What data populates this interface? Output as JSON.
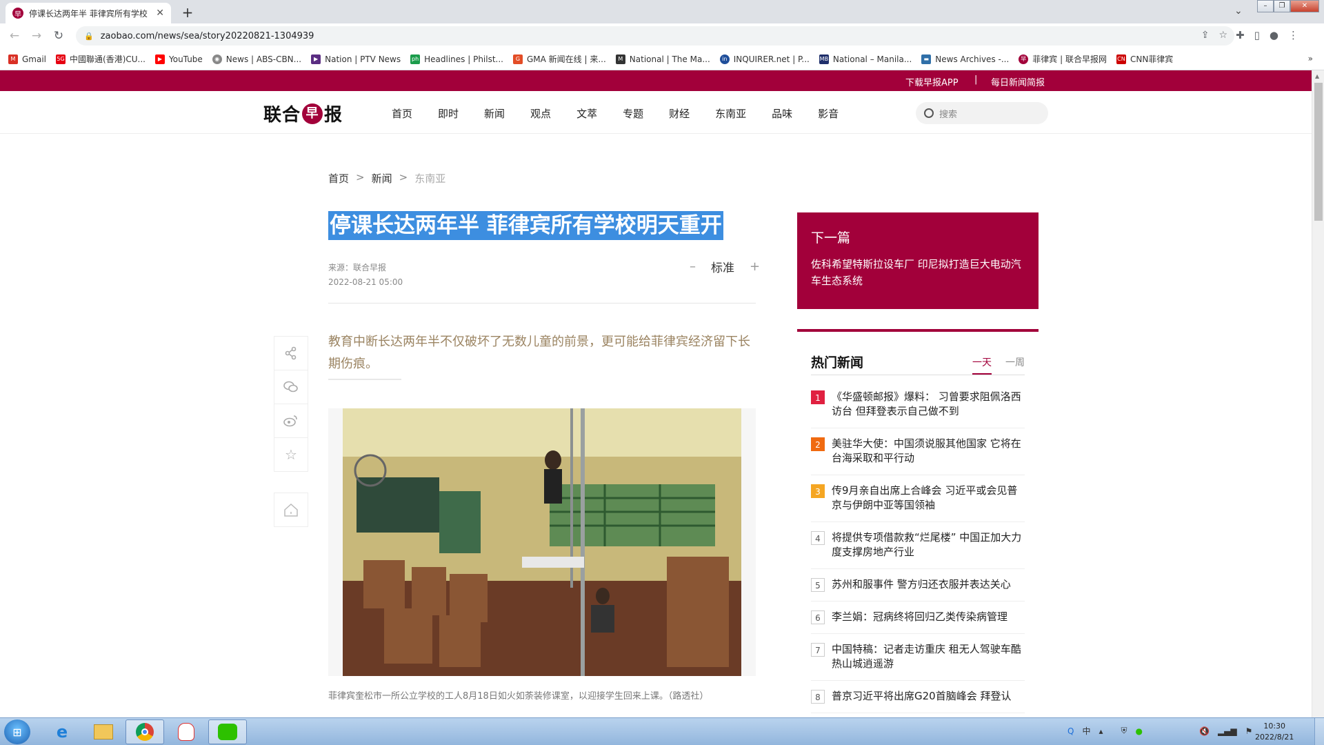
{
  "browser": {
    "tab_title": "停课长达两年半 菲律宾所有学校",
    "favicon_text": "早",
    "url": "zaobao.com/news/sea/story20220821-1304939",
    "bookmarks": [
      {
        "label": "Gmail",
        "color": "#d93025"
      },
      {
        "label": "中國聯通(香港)CU...",
        "color": "#e60012"
      },
      {
        "label": "YouTube",
        "color": "#ff0000"
      },
      {
        "label": "News | ABS-CBN...",
        "color": "#888888"
      },
      {
        "label": "Nation | PTV News",
        "color": "#5a2d82"
      },
      {
        "label": "Headlines | Philst...",
        "color": "#1b9c4b"
      },
      {
        "label": "GMA 新闻在线 | 来...",
        "color": "#e34d26"
      },
      {
        "label": "National | The Ma...",
        "color": "#333333"
      },
      {
        "label": "INQUIRER.net | P...",
        "color": "#1f4e9a"
      },
      {
        "label": "National – Manila...",
        "color": "#1f2f6b"
      },
      {
        "label": "News Archives -...",
        "color": "#2f6fa8"
      },
      {
        "label": "菲律宾 | 联合早报网",
        "color": "#a2003a"
      },
      {
        "label": "CNN菲律宾",
        "color": "#cc0000"
      }
    ]
  },
  "site": {
    "top_links": [
      "下载早报APP",
      "|",
      "每日新闻简报"
    ],
    "logo": {
      "left": "联合",
      "mid": "早",
      "right": "报"
    },
    "nav": [
      "首页",
      "即时",
      "新闻",
      "观点",
      "文萃",
      "专题",
      "财经",
      "东南亚",
      "品味",
      "影音"
    ],
    "search_placeholder": "搜索",
    "accent": "#a2003a"
  },
  "article": {
    "breadcrumb": [
      "首页",
      "新闻",
      "东南亚"
    ],
    "headline": "停课长达两年半 菲律宾所有学校明天重开",
    "source": "来源：联合早报",
    "date": "2022-08-21 05:00",
    "font_minus": "–",
    "font_label": "标准",
    "font_plus": "+",
    "lede": "教育中断长达两年半不仅破坏了无数儿童的前景，更可能给菲律宾经济留下长期伤痕。",
    "caption": "菲律宾奎松市一所公立学校的工人8月18日如火如荼装修课室，以迎接学生回来上课。（路透社）"
  },
  "next_article": {
    "label": "下一篇",
    "title": "佐科希望特斯拉设车厂 印尼拟打造巨大电动汽车生态系统"
  },
  "hot_news": {
    "title": "热门新闻",
    "tabs": [
      "一天",
      "一周"
    ],
    "items": [
      {
        "rank": "1",
        "text": "《华盛顿邮报》爆料： 习曾要求阻佩洛西访台 但拜登表示自己做不到"
      },
      {
        "rank": "2",
        "text": "美驻华大使：中国须说服其他国家 它将在台海采取和平行动"
      },
      {
        "rank": "3",
        "text": "传9月亲自出席上合峰会 习近平或会见普京与伊朗中亚等国领袖"
      },
      {
        "rank": "4",
        "text": "将提供专项借款救“烂尾楼” 中国正加大力度支撑房地产行业"
      },
      {
        "rank": "5",
        "text": "苏州和服事件 警方归还衣服并表达关心"
      },
      {
        "rank": "6",
        "text": "李兰娟：冠病终将回归乙类传染病管理"
      },
      {
        "rank": "7",
        "text": "中国特稿：记者走访重庆 租无人驾驶车酷热山城逍遥游"
      },
      {
        "rank": "8",
        "text": "普京习近平将出席G20首脑峰会 拜登认"
      }
    ]
  },
  "taskbar": {
    "ime": "中",
    "time": "10:30",
    "date": "2022/8/21"
  }
}
